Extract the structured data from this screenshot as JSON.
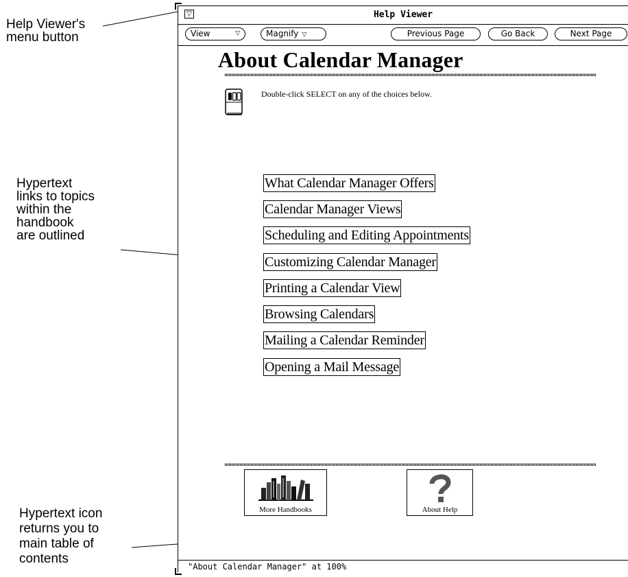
{
  "annotations": {
    "menu_button": "Help Viewer's\nmenu button",
    "hypertext_links": "Hypertext\nlinks to topics\nwithin the\nhandbook\nare outlined",
    "hypertext_icon": "Hypertext icon\nreturns you to\nmain table of\ncontents"
  },
  "window": {
    "title": "Help Viewer",
    "menu_button_glyph": "▽"
  },
  "controls": {
    "view_label": "View",
    "magnify_label": "Magnify",
    "dropdown_glyph": "▽",
    "previous_page_label": "Previous Page",
    "go_back_label": "Go Back",
    "next_page_label": "Next Page"
  },
  "page": {
    "title": "About Calendar Manager",
    "instruction": "Double-click SELECT on any of the choices below.",
    "links": [
      "What Calendar Manager Offers",
      "Calendar Manager Views",
      "Scheduling and Editing Appointments",
      "Customizing Calendar Manager",
      "Printing a Calendar View",
      "Browsing Calendars",
      "Mailing a Calendar Reminder",
      "Opening a Mail Message"
    ]
  },
  "footer_buttons": {
    "more_handbooks_label": "More Handbooks",
    "about_help_label": "About Help"
  },
  "status": {
    "text": "\"About Calendar Manager\" at 100%"
  },
  "icons": {
    "menu_button": "triangle-down-icon",
    "mouse": "mouse-icon",
    "handbooks": "books-icon",
    "help": "question-mark-icon"
  }
}
